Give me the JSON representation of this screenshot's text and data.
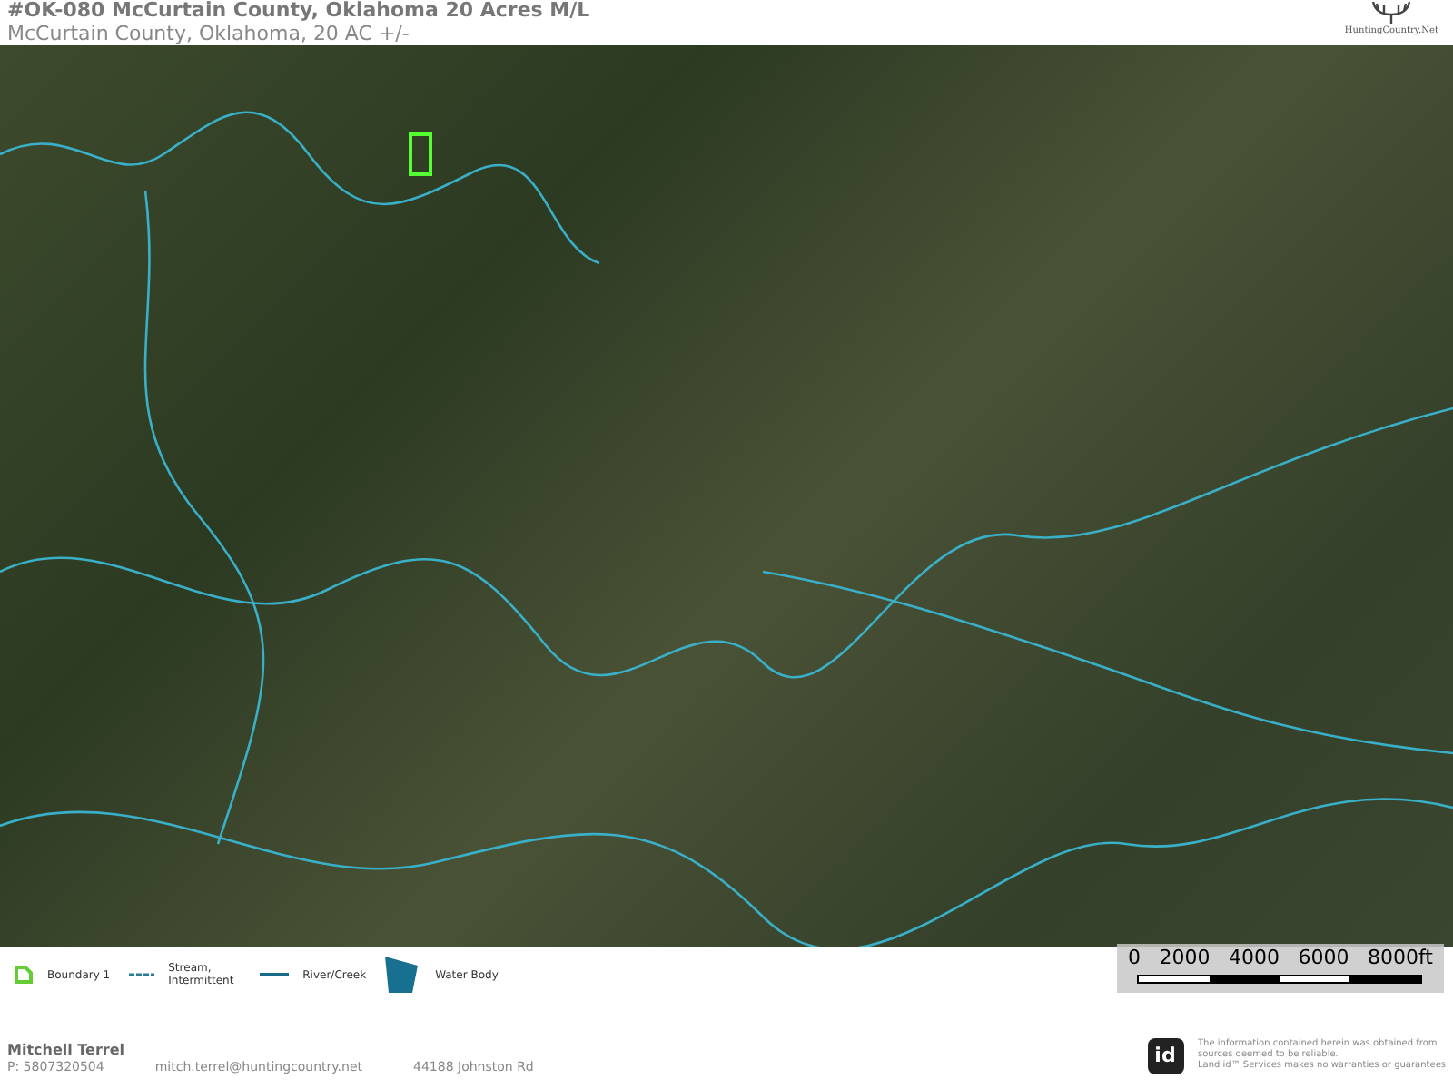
{
  "header": {
    "title": "#OK-080 McCurtain County, Oklahoma 20 Acres M/L",
    "subtitle": "McCurtain County, Oklahoma, 20 AC +/-",
    "logo_text": "HuntingCountry.Net"
  },
  "map": {
    "scale_labels": [
      "0",
      "2000",
      "4000",
      "6000",
      "8000ft"
    ]
  },
  "legend": [
    {
      "kind": "boundary",
      "label": "Boundary 1"
    },
    {
      "kind": "stream",
      "label": "Stream, Intermittent"
    },
    {
      "kind": "river",
      "label": "River/Creek"
    },
    {
      "kind": "water",
      "label": "Water Body"
    }
  ],
  "footer": {
    "logo_text": "id",
    "name": "Mitchell Terrel",
    "phone": "P: 5807320504",
    "email": "mitch.terrel@huntingcountry.net",
    "address": "44188 Johnston Rd",
    "disclaimer": [
      "The information contained herein was obtained from",
      "sources deemed to be reliable.",
      "Land id™ Services makes no warranties or guarantees"
    ]
  }
}
